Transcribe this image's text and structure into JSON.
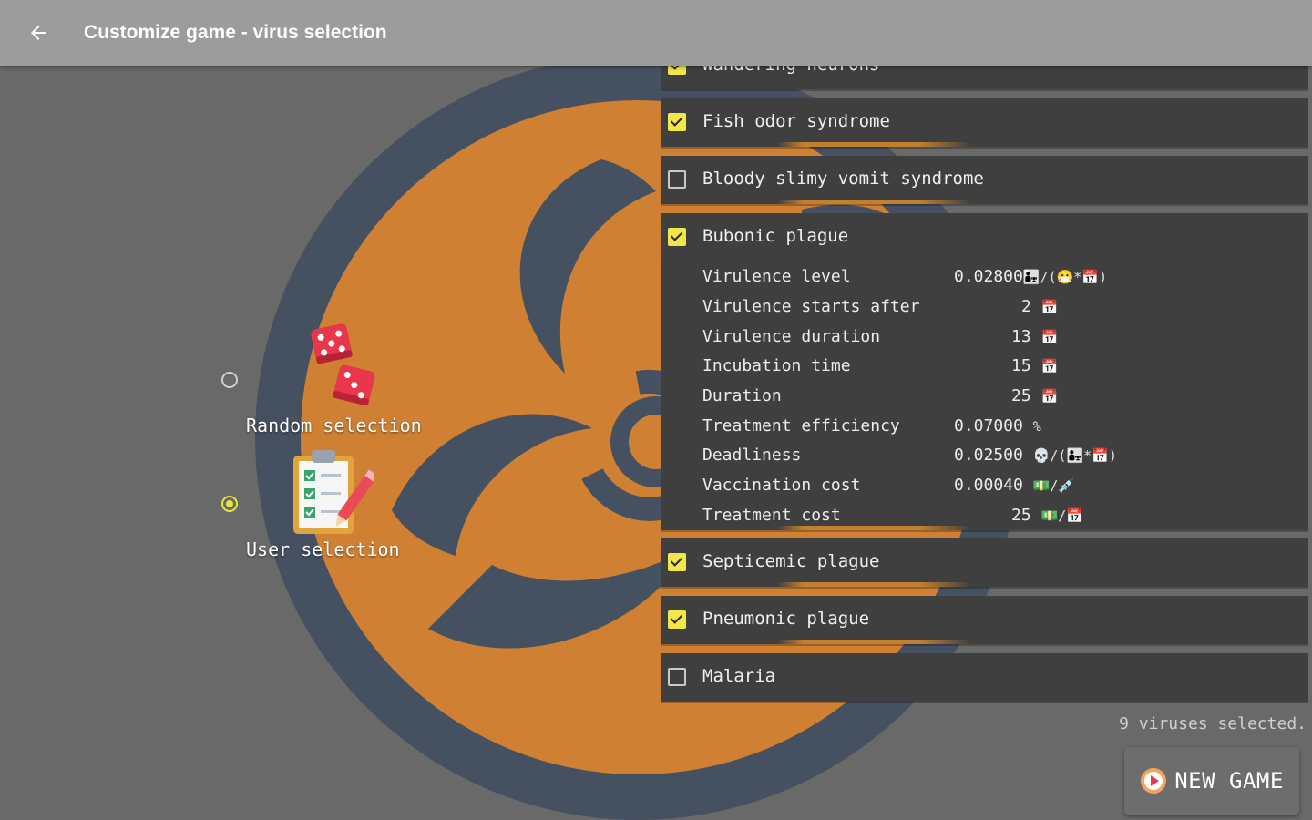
{
  "app_bar": {
    "title": "Customize game - virus selection",
    "back_icon": "arrow-left-icon"
  },
  "selection_mode": {
    "options": [
      {
        "label": "Random selection",
        "icon": "dice-icon",
        "selected": false
      },
      {
        "label": "User selection",
        "icon": "clipboard-checklist-icon",
        "selected": true
      }
    ]
  },
  "viruses": {
    "partial_top": "Wandering neurons",
    "items": [
      {
        "name": "Fish odor syndrome",
        "checked": true
      },
      {
        "name": "Bloody slimy vomit syndrome",
        "checked": false
      },
      {
        "name": "Bubonic plague",
        "checked": true
      },
      {
        "name": "Septicemic plague",
        "checked": true
      },
      {
        "name": "Pneumonic plague",
        "checked": true
      },
      {
        "name": "Malaria",
        "checked": false
      }
    ],
    "expanded_details": [
      {
        "label": "Virulence level",
        "value": "0.02800",
        "unit": "👨‍👧/(😷*📅)"
      },
      {
        "label": "Virulence starts after",
        "value": "2",
        "unit": "📅"
      },
      {
        "label": "Virulence duration",
        "value": "13",
        "unit": "📅"
      },
      {
        "label": "Incubation time",
        "value": "15",
        "unit": "📅"
      },
      {
        "label": "Duration",
        "value": "25",
        "unit": "📅"
      },
      {
        "label": "Treatment efficiency",
        "value": "0.07000",
        "unit": "%"
      },
      {
        "label": "Deadliness",
        "value": "0.02500",
        "unit": "💀/(👨‍👧*📅)"
      },
      {
        "label": "Vaccination cost",
        "value": "0.00040",
        "unit": "💵/💉"
      },
      {
        "label": "Treatment cost",
        "value": "25",
        "unit": "💵/📅"
      }
    ]
  },
  "status": "9 viruses selected.",
  "new_game": {
    "label": "NEW GAME",
    "icon": "play-circle-icon"
  },
  "colors": {
    "background": "#696969",
    "app_bar": "#9c9c9c",
    "biohazard_orange": "#cf8033",
    "biohazard_slate": "#455060",
    "checkbox_yellow": "#f2e64a",
    "row_bg": "#3f3f3f"
  }
}
